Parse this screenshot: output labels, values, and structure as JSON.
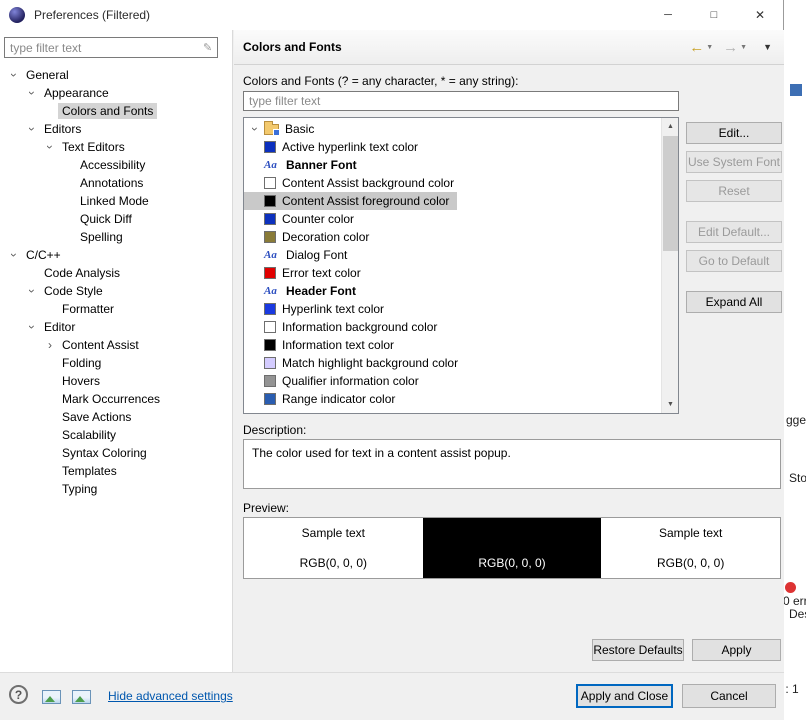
{
  "window": {
    "title": "Preferences (Filtered)",
    "minimize_icon": "─",
    "maximize_icon": "□",
    "close_icon": "✕"
  },
  "icons": {
    "chevron": "›",
    "filter": "✎",
    "back_arrow": "←",
    "forward_arrow": "→",
    "dropdown": "▼",
    "scroll_up": "▲",
    "scroll_down": "▼",
    "help": "?",
    "font_sample": "Aa"
  },
  "sidebar": {
    "filter_placeholder": "type filter text",
    "tree": [
      {
        "label": "General",
        "level": 0,
        "chevron": "expanded"
      },
      {
        "label": "Appearance",
        "level": 1,
        "chevron": "expanded"
      },
      {
        "label": "Colors and Fonts",
        "level": 2,
        "chevron": "none",
        "selected": true
      },
      {
        "label": "Editors",
        "level": 1,
        "chevron": "expanded"
      },
      {
        "label": "Text Editors",
        "level": 2,
        "chevron": "expanded"
      },
      {
        "label": "Accessibility",
        "level": 3,
        "chevron": "none"
      },
      {
        "label": "Annotations",
        "level": 3,
        "chevron": "none"
      },
      {
        "label": "Linked Mode",
        "level": 3,
        "chevron": "none"
      },
      {
        "label": "Quick Diff",
        "level": 3,
        "chevron": "none"
      },
      {
        "label": "Spelling",
        "level": 3,
        "chevron": "none"
      },
      {
        "label": "C/C++",
        "level": 0,
        "chevron": "expanded"
      },
      {
        "label": "Code Analysis",
        "level": 1,
        "chevron": "none"
      },
      {
        "label": "Code Style",
        "level": 1,
        "chevron": "expanded"
      },
      {
        "label": "Formatter",
        "level": 2,
        "chevron": "none"
      },
      {
        "label": "Editor",
        "level": 1,
        "chevron": "expanded"
      },
      {
        "label": "Content Assist",
        "level": 2,
        "chevron": "collapsed"
      },
      {
        "label": "Folding",
        "level": 2,
        "chevron": "none"
      },
      {
        "label": "Hovers",
        "level": 2,
        "chevron": "none"
      },
      {
        "label": "Mark Occurrences",
        "level": 2,
        "chevron": "none"
      },
      {
        "label": "Save Actions",
        "level": 2,
        "chevron": "none"
      },
      {
        "label": "Scalability",
        "level": 2,
        "chevron": "none"
      },
      {
        "label": "Syntax Coloring",
        "level": 2,
        "chevron": "none"
      },
      {
        "label": "Templates",
        "level": 2,
        "chevron": "none"
      },
      {
        "label": "Typing",
        "level": 2,
        "chevron": "none"
      }
    ]
  },
  "main": {
    "page_title": "Colors and Fonts",
    "filter_label": "Colors and Fonts (? = any character, * = any string):",
    "filter_placeholder": "type filter text",
    "list": [
      {
        "label": "Basic",
        "icon": "folder",
        "chevron": "expanded"
      },
      {
        "label": "Active hyperlink text color",
        "icon": "color",
        "color": "#0b2fbe",
        "chevron": "none"
      },
      {
        "label": "Banner Font",
        "icon": "font",
        "bold": true,
        "chevron": "none"
      },
      {
        "label": "Content Assist background color",
        "icon": "color",
        "color": "#ffffff",
        "chevron": "none"
      },
      {
        "label": "Content Assist foreground color",
        "icon": "color",
        "color": "#000000",
        "chevron": "none",
        "selected": true
      },
      {
        "label": "Counter color",
        "icon": "color",
        "color": "#0d31bd",
        "chevron": "none"
      },
      {
        "label": "Decoration color",
        "icon": "color",
        "color": "#897b38",
        "chevron": "none"
      },
      {
        "label": "Dialog Font",
        "icon": "font",
        "chevron": "none"
      },
      {
        "label": "Error text color",
        "icon": "color",
        "color": "#e00000",
        "chevron": "none"
      },
      {
        "label": "Header Font",
        "icon": "font",
        "bold": true,
        "chevron": "none"
      },
      {
        "label": "Hyperlink text color",
        "icon": "color",
        "color": "#1a39e0",
        "chevron": "none"
      },
      {
        "label": "Information background color",
        "icon": "color",
        "color": "#ffffff",
        "chevron": "none"
      },
      {
        "label": "Information text color",
        "icon": "color",
        "color": "#000000",
        "chevron": "none"
      },
      {
        "label": "Match highlight background color",
        "icon": "color",
        "color": "#d4ccff",
        "chevron": "none"
      },
      {
        "label": "Qualifier information color",
        "icon": "color",
        "color": "#949494",
        "chevron": "none"
      },
      {
        "label": "Range indicator color",
        "icon": "color",
        "color": "#2a5db0",
        "chevron": "none"
      }
    ],
    "side_buttons": [
      {
        "label": "Edit...",
        "enabled": true
      },
      {
        "label": "Use System Font",
        "enabled": false
      },
      {
        "label": "Reset",
        "enabled": false
      },
      {
        "label": "Edit Default...",
        "enabled": false
      },
      {
        "label": "Go to Default",
        "enabled": false
      },
      {
        "label": "Expand All",
        "enabled": true
      }
    ],
    "description_label": "Description:",
    "description_text": "The color used for text in a content assist popup.",
    "preview_label": "Preview:",
    "preview_cells": [
      {
        "text": "Sample text",
        "theme": "light"
      },
      {
        "text": "",
        "theme": "dark"
      },
      {
        "text": "Sample text",
        "theme": "light"
      },
      {
        "text": "RGB(0, 0, 0)",
        "theme": "light"
      },
      {
        "text": "RGB(0, 0, 0)",
        "theme": "dark"
      },
      {
        "text": "RGB(0, 0, 0)",
        "theme": "light"
      }
    ],
    "restore_defaults_label": "Restore Defaults",
    "apply_label": "Apply"
  },
  "footer": {
    "link_label": "Hide advanced settings",
    "apply_close_label": "Apply and Close",
    "cancel_label": "Cancel"
  },
  "background": {
    "fragment_1": "gge",
    "fragment_2": "Sto",
    "fragment_3": "0 err",
    "fragment_4": "Des",
    "fragment_5": ") : 1"
  }
}
